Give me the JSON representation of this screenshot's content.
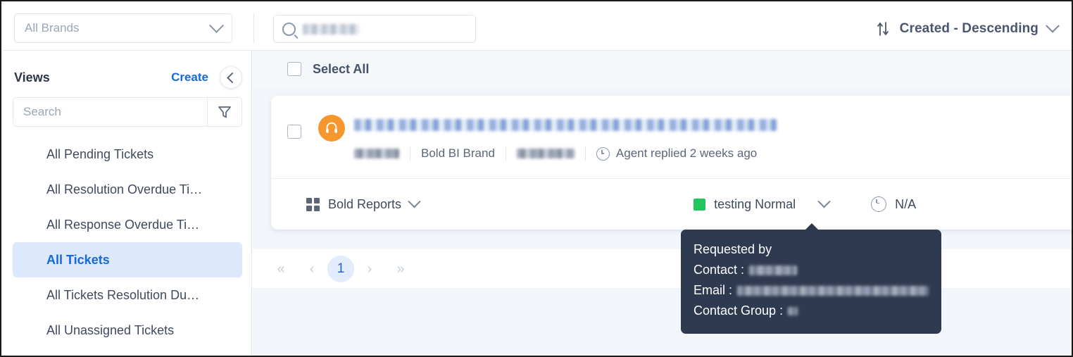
{
  "topbar": {
    "brand_filter_placeholder": "All Brands",
    "search_placeholder": "",
    "search_value_redacted": true,
    "sort_label": "Created - Descending",
    "sort_icon": "sort-arrows-icon"
  },
  "sidebar": {
    "title": "Views",
    "create_label": "Create",
    "collapse_icon": "chevron-left-icon",
    "search_placeholder": "Search",
    "filter_icon": "funnel-icon",
    "items": [
      {
        "label": "All Pending Tickets",
        "active": false
      },
      {
        "label": "All Resolution Overdue Ti…",
        "active": false
      },
      {
        "label": "All Response Overdue Ti…",
        "active": false
      },
      {
        "label": "All Tickets",
        "active": true
      },
      {
        "label": "All Tickets Resolution Du…",
        "active": false
      },
      {
        "label": "All Unassigned Tickets",
        "active": false
      }
    ]
  },
  "main": {
    "select_all_label": "Select All",
    "ticket": {
      "avatar_icon": "headset-icon",
      "title_redacted": true,
      "meta": {
        "id_redacted": true,
        "brand": "Bold BI Brand",
        "agent_redacted": true,
        "activity_icon": "clock-history-icon",
        "activity": "Agent replied 2 weeks ago"
      },
      "footer": {
        "category_icon": "grid-icon",
        "category": "Bold Reports",
        "status_color": "#22c55e",
        "status": "testing Normal",
        "due_icon": "clock-icon",
        "due": "N/A"
      }
    },
    "tooltip": {
      "title": "Requested by",
      "contact_label": "Contact :",
      "email_label": "Email :",
      "group_label": "Contact Group :",
      "contact_redacted": true,
      "email_redacted": true,
      "group_redacted": true
    },
    "pagination": {
      "first": "«",
      "prev": "‹",
      "current": "1",
      "next": "›",
      "last": "»"
    }
  },
  "colors": {
    "accent_blue": "#1668dc",
    "avatar_orange": "#f5962e",
    "status_green": "#22c55e",
    "tooltip_bg": "#2e3a4f",
    "page_bg": "#f2f6fa"
  }
}
